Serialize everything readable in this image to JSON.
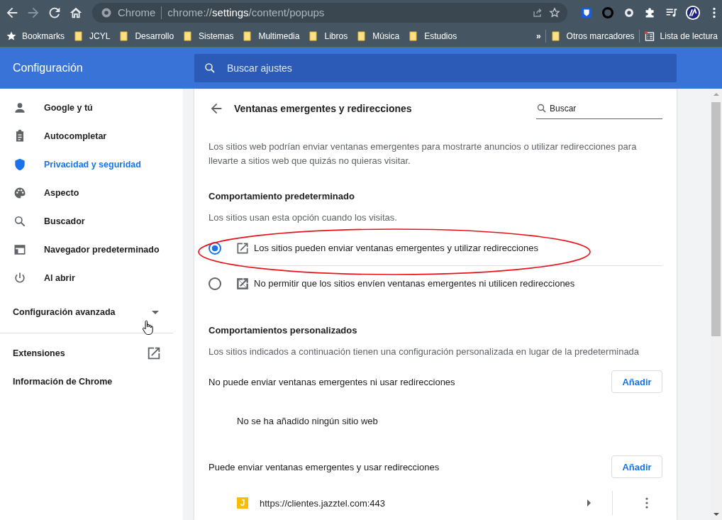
{
  "toolbar": {
    "site_label": "Chrome",
    "url_scheme": "chrome://",
    "url_host": "settings",
    "url_path": "/content/popups"
  },
  "bookmarks": [
    {
      "label": "Bookmarks",
      "kind": "star"
    },
    {
      "label": "JCYL",
      "kind": "folder"
    },
    {
      "label": "Desarrollo",
      "kind": "folder"
    },
    {
      "label": "Sistemas",
      "kind": "folder"
    },
    {
      "label": "Multimedia",
      "kind": "folder"
    },
    {
      "label": "Libros",
      "kind": "folder"
    },
    {
      "label": "Música",
      "kind": "folder"
    },
    {
      "label": "Estudios",
      "kind": "folder"
    }
  ],
  "bookmarks_overflow": "»",
  "other_bookmarks": "Otros marcadores",
  "reading_list": "Lista de lectura",
  "header": {
    "title": "Configuración",
    "search_placeholder": "Buscar ajustes"
  },
  "sidebar": {
    "items": [
      {
        "label": "Google y tú",
        "selected": false
      },
      {
        "label": "Autocompletar",
        "selected": false
      },
      {
        "label": "Privacidad y seguridad",
        "selected": true
      },
      {
        "label": "Aspecto",
        "selected": false
      },
      {
        "label": "Buscador",
        "selected": false
      },
      {
        "label": "Navegador predeterminado",
        "selected": false
      },
      {
        "label": "Al abrir",
        "selected": false
      }
    ],
    "advanced": "Configuración avanzada",
    "extensions": "Extensiones",
    "about": "Información de Chrome"
  },
  "page": {
    "title": "Ventanas emergentes y redirecciones",
    "search_placeholder": "Buscar",
    "description": "Los sitios web podrían enviar ventanas emergentes para mostrarte anuncios o utilizar redirecciones para llevarte a sitios web que quizás no quieras visitar.",
    "default_heading": "Comportamiento predeterminado",
    "default_hint": "Los sitios usan esta opción cuando los visitas.",
    "options": [
      {
        "label": "Los sitios pueden enviar ventanas emergentes y utilizar redirecciones",
        "kind": "allow",
        "selected": true
      },
      {
        "label": "No permitir que los sitios envíen ventanas emergentes ni utilicen redirecciones",
        "kind": "block",
        "selected": false
      }
    ],
    "custom_heading": "Comportamientos personalizados",
    "custom_hint": "Los sitios indicados a continuación tienen una configuración personalizada en lugar de la predeterminada",
    "lists": [
      {
        "title": "No puede enviar ventanas emergentes ni usar redirecciones",
        "button": "Añadir",
        "empty_text": "No se ha añadido ningún sitio web"
      },
      {
        "title": "Puede enviar ventanas emergentes y usar redirecciones",
        "button": "Añadir",
        "sites": [
          {
            "favicon": "J",
            "url": "https://clientes.jazztel.com:443"
          }
        ]
      }
    ]
  }
}
